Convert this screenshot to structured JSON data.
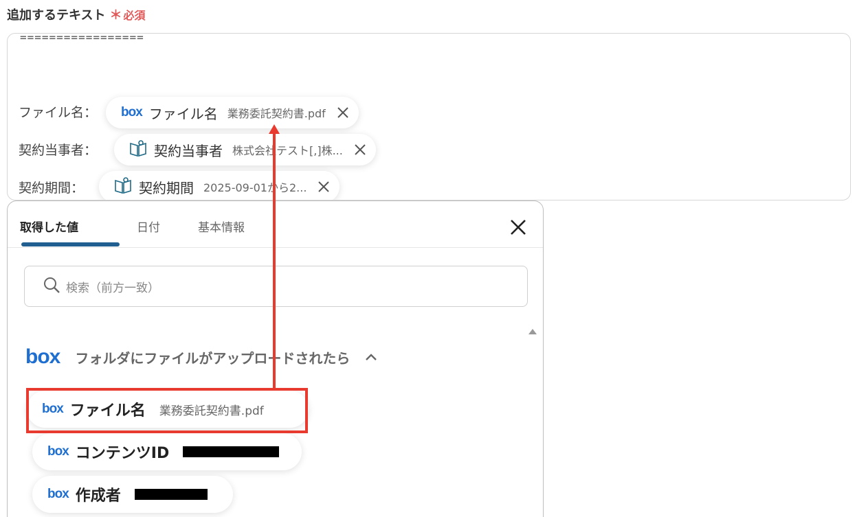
{
  "form": {
    "label": "追加するテキスト",
    "required_mark": "＊",
    "required_text": "必須"
  },
  "editor": {
    "separator": "=================",
    "rows": [
      {
        "label": "ファイル名：",
        "chip_icon": "box-icon",
        "chip_name": "ファイル名",
        "chip_value": "業務委託契約書.pdf"
      },
      {
        "label": "契約当事者：",
        "chip_icon": "book-icon",
        "chip_name": "契約当事者",
        "chip_value": "株式会社テスト[,]株..."
      },
      {
        "label": "契約期間：",
        "chip_icon": "book-icon",
        "chip_name": "契約期間",
        "chip_value": "2025-09-01から2..."
      }
    ]
  },
  "panel": {
    "tabs": [
      {
        "label": "取得した値",
        "active": true
      },
      {
        "label": "日付",
        "active": false
      },
      {
        "label": "基本情報",
        "active": false
      }
    ],
    "search_placeholder": "検索（前方一致）",
    "group": {
      "logo": "box",
      "title": "フォルダにファイルがアップロードされたら"
    },
    "items": [
      {
        "logo": "box",
        "name": "ファイル名",
        "value": "業務委託契約書.pdf",
        "redacted": false
      },
      {
        "logo": "box",
        "name": "コンテンツID",
        "value": "",
        "redacted": true
      },
      {
        "logo": "box",
        "name": "作成者",
        "value": "",
        "redacted": true
      }
    ]
  },
  "colors": {
    "accent_tab": "#205f8f",
    "box_blue": "#1f6fd1",
    "highlight_red": "#e83a2f",
    "required_red": "#e05a5a"
  }
}
